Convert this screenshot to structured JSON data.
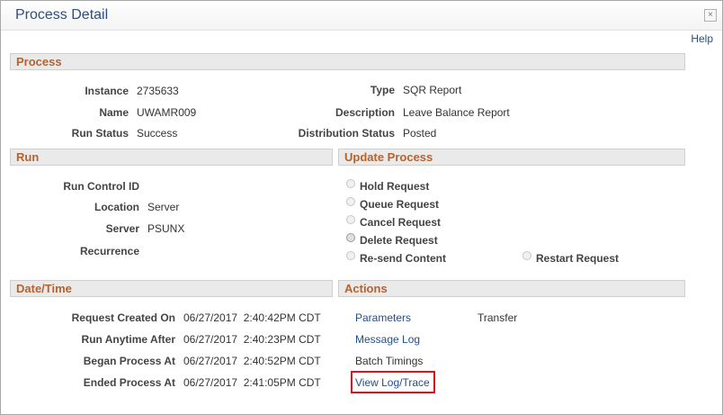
{
  "dialog": {
    "title": "Process Detail",
    "close_symbol": "×",
    "help_label": "Help"
  },
  "process": {
    "heading": "Process",
    "instance_label": "Instance",
    "instance_value": "2735633",
    "type_label": "Type",
    "type_value": "SQR Report",
    "name_label": "Name",
    "name_value": "UWAMR009",
    "description_label": "Description",
    "description_value": "Leave Balance Report",
    "run_status_label": "Run Status",
    "run_status_value": "Success",
    "distribution_status_label": "Distribution Status",
    "distribution_status_value": "Posted"
  },
  "run": {
    "heading": "Run",
    "run_control_id_label": "Run Control ID",
    "run_control_id_value": "",
    "location_label": "Location",
    "location_value": "Server",
    "server_label": "Server",
    "server_value": "PSUNX",
    "recurrence_label": "Recurrence",
    "recurrence_value": ""
  },
  "update_process": {
    "heading": "Update Process",
    "options": [
      {
        "label": "Hold Request"
      },
      {
        "label": "Queue Request"
      },
      {
        "label": "Cancel Request"
      },
      {
        "label": "Delete Request"
      },
      {
        "label": "Re-send Content"
      },
      {
        "label": "Restart Request"
      }
    ]
  },
  "datetime": {
    "heading": "Date/Time",
    "request_created_label": "Request Created On",
    "request_created_value": "06/27/2017  2:40:42PM CDT",
    "run_anytime_label": "Run Anytime After",
    "run_anytime_value": "06/27/2017  2:40:23PM CDT",
    "began_label": "Began Process At",
    "began_value": "06/27/2017  2:40:52PM CDT",
    "ended_label": "Ended Process At",
    "ended_value": "06/27/2017  2:41:05PM CDT"
  },
  "actions": {
    "heading": "Actions",
    "parameters": "Parameters",
    "transfer": "Transfer",
    "message_log": "Message Log",
    "batch_timings": "Batch Timings",
    "view_log_trace": "View Log/Trace",
    "highlight_color": "#d9141c"
  }
}
